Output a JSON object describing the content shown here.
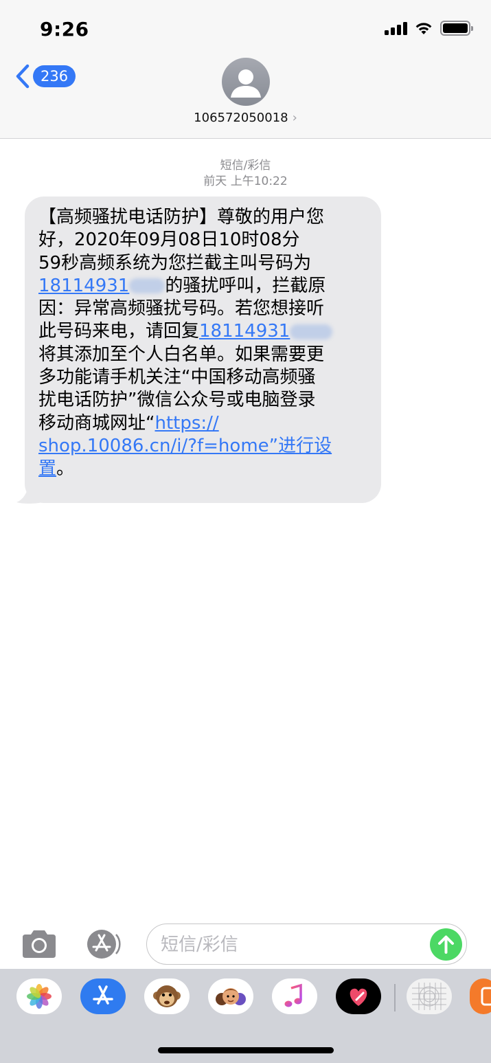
{
  "status_bar": {
    "time": "9:26"
  },
  "nav": {
    "back_count": "236",
    "contact_number": "106572050018",
    "contact_chevron": "›"
  },
  "conversation": {
    "message_type": "短信/彩信",
    "timestamp": "前天 上午10:22",
    "message": {
      "l1": "【高频骚扰电话防护】尊敬的用户您",
      "l2": "好，2020年09月08日10时08分",
      "l3": "59秒高频系统为您拦截主叫号码为",
      "l4_link": "18114931",
      "l4_rest": "的骚扰呼叫，拦截原",
      "l5": "因：异常高频骚扰号码。若您想接听",
      "l6_text": "此号码来电，请回复",
      "l6_link": "18114931",
      "l7": "将其添加至个人白名单。如果需要更",
      "l8": "多功能请手机关注“中国移动高频骚",
      "l9": "扰电话防护”微信公众号或电脑登录",
      "l10_text": "移动商城网址“",
      "l10_link": "https://",
      "l11_link": "shop.10086.cn/i/?f=home”进行设",
      "l12_link": "置",
      "l12_end": "。"
    }
  },
  "input_bar": {
    "placeholder": "短信/彩信"
  },
  "app_drawer": {
    "apps": [
      "photos-icon",
      "app-store-icon",
      "animoji-icon",
      "memoji-icon",
      "music-icon",
      "digital-touch-icon",
      "stickers-icon",
      "partial-app-icon"
    ]
  },
  "colors": {
    "link": "#3478f6",
    "bubble": "#e9e9eb",
    "send": "#4cd864",
    "badge": "#3478f6"
  }
}
